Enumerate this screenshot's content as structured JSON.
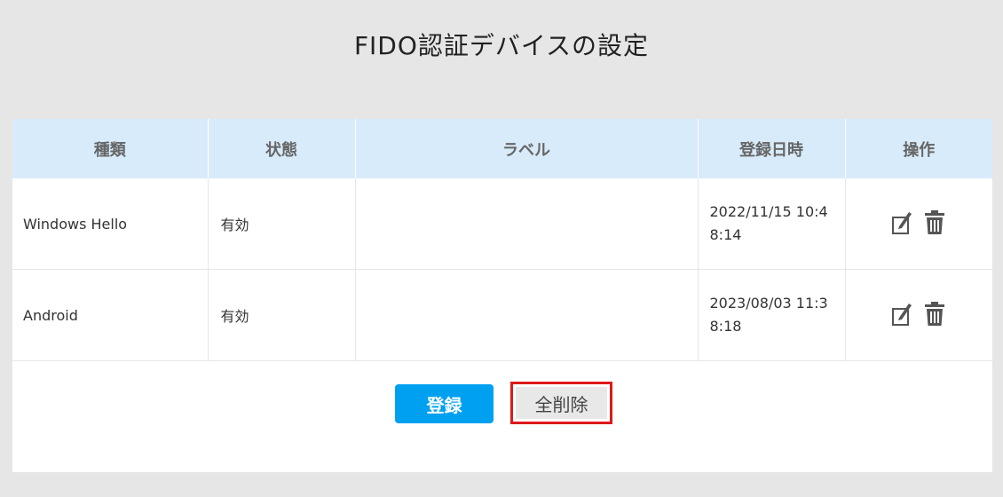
{
  "header": {
    "title": "FIDO認証デバイスの設定"
  },
  "table": {
    "columns": [
      "種類",
      "状態",
      "ラベル",
      "登録日時",
      "操作"
    ],
    "rows": [
      {
        "type": "Windows Hello",
        "status": "有効",
        "label": "",
        "registered": "2022/11/15 10:48:14",
        "actions": [
          "edit-icon",
          "trash-icon"
        ]
      },
      {
        "type": "Android",
        "status": "有効",
        "label": "",
        "registered": "2023/08/03 11:38:18",
        "actions": [
          "edit-icon",
          "trash-icon"
        ]
      }
    ]
  },
  "buttons": {
    "register": "登録",
    "delete_all": "全削除"
  },
  "colors": {
    "header_bg": "#d8ebfa",
    "register_btn": "#00a0f0",
    "highlight_border": "#dd1a1a",
    "page_bg": "#e6e6e6"
  }
}
